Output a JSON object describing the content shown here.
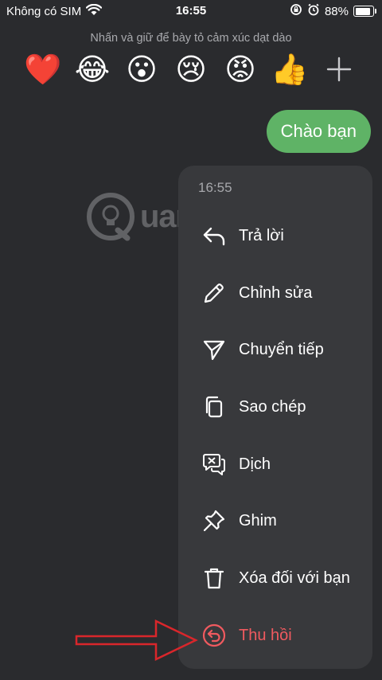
{
  "status": {
    "carrier": "Không có SIM",
    "time": "16:55",
    "battery_percent": 88,
    "battery_text": "88%"
  },
  "hint_text": "Nhấn và giữ để bày tỏ cảm xúc dạt dào",
  "reactions": [
    "❤️",
    "😂",
    "😮",
    "😢",
    "😡",
    "👍"
  ],
  "message": {
    "text": "Chào bạn"
  },
  "watermark": "uantrimang",
  "menu": {
    "time": "16:55",
    "items": [
      {
        "label": "Trả lời",
        "icon": "reply-icon"
      },
      {
        "label": "Chỉnh sửa",
        "icon": "pencil-icon"
      },
      {
        "label": "Chuyển tiếp",
        "icon": "send-icon"
      },
      {
        "label": "Sao chép",
        "icon": "copy-icon"
      },
      {
        "label": "Dịch",
        "icon": "translate-icon"
      },
      {
        "label": "Ghim",
        "icon": "pin-icon"
      },
      {
        "label": "Xóa đối với bạn",
        "icon": "trash-icon"
      },
      {
        "label": "Thu hồi",
        "icon": "unsend-icon"
      }
    ]
  },
  "colors": {
    "background": "#2a2b2e",
    "menu_background": "#38393c",
    "bubble": "#5fb366",
    "danger": "#f05a5f",
    "arrow": "#d9262b"
  }
}
